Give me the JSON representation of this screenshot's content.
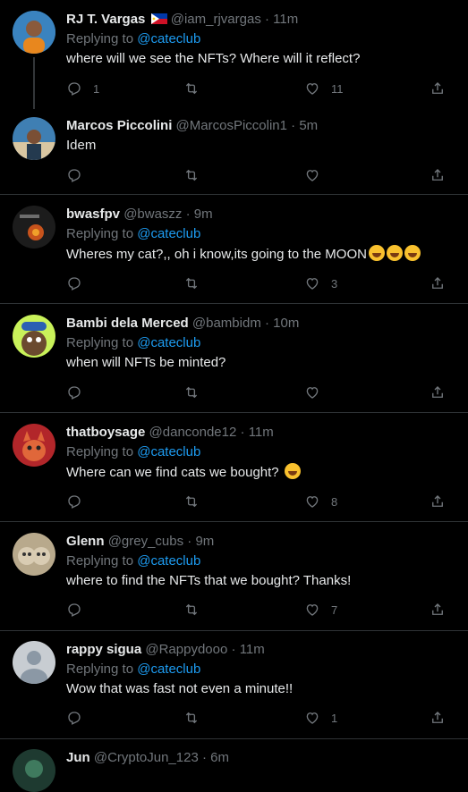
{
  "tweets": [
    {
      "name": "RJ T. Vargas",
      "handle": "@iam_rjvargas",
      "time": "11m",
      "reply_prefix": "Replying to",
      "mention": "@cateclub",
      "text": "where will we see the NFTs? Where will it reflect?",
      "reply_count": "1",
      "retweet_count": "",
      "like_count": "11",
      "avatar_color": "#2d6fa3",
      "flag": true
    },
    {
      "name": "Marcos Piccolini",
      "handle": "@MarcosPiccolin1",
      "time": "5m",
      "reply_prefix": "",
      "mention": "",
      "text": "Idem",
      "reply_count": "",
      "retweet_count": "",
      "like_count": "",
      "avatar_color": "#5b7ea0"
    },
    {
      "name": "bwasfpv",
      "handle": "@bwaszz",
      "time": "9m",
      "reply_prefix": "Replying to",
      "mention": "@cateclub",
      "text": "Wheres my cat?,, oh i know,its going to the MOON",
      "emoji_count": 3,
      "reply_count": "",
      "retweet_count": "",
      "like_count": "3",
      "avatar_color": "#2a2a2a"
    },
    {
      "name": "Bambi dela Merced",
      "handle": "@bambidm",
      "time": "10m",
      "reply_prefix": "Replying to",
      "mention": "@cateclub",
      "text": "when will NFTs be minted?",
      "reply_count": "",
      "retweet_count": "",
      "like_count": "",
      "avatar_color": "#c9f25a"
    },
    {
      "name": "thatboysage",
      "handle": "@danconde12",
      "time": "11m",
      "reply_prefix": "Replying to",
      "mention": "@cateclub",
      "text": "Where can we find cats we bought?",
      "emoji_count": 1,
      "reply_count": "",
      "retweet_count": "",
      "like_count": "8",
      "avatar_color": "#b2262a"
    },
    {
      "name": "Glenn",
      "handle": "@grey_cubs",
      "time": "9m",
      "reply_prefix": "Replying to",
      "mention": "@cateclub",
      "text": "where to find the NFTs that we bought? Thanks!",
      "reply_count": "",
      "retweet_count": "",
      "like_count": "7",
      "avatar_color": "#cfc2a8"
    },
    {
      "name": "rappy sigua",
      "handle": "@Rappydooo",
      "time": "11m",
      "reply_prefix": "Replying to",
      "mention": "@cateclub",
      "text": "Wow that was fast not even a minute!!",
      "reply_count": "",
      "retweet_count": "",
      "like_count": "1",
      "avatar_color": "#c8cdd2"
    },
    {
      "name": "Jun",
      "handle": "@CryptoJun_123",
      "time": "6m",
      "reply_prefix": "",
      "mention": "",
      "text": "",
      "reply_count": "",
      "retweet_count": "",
      "like_count": "",
      "avatar_color": "#1e3a30"
    }
  ]
}
